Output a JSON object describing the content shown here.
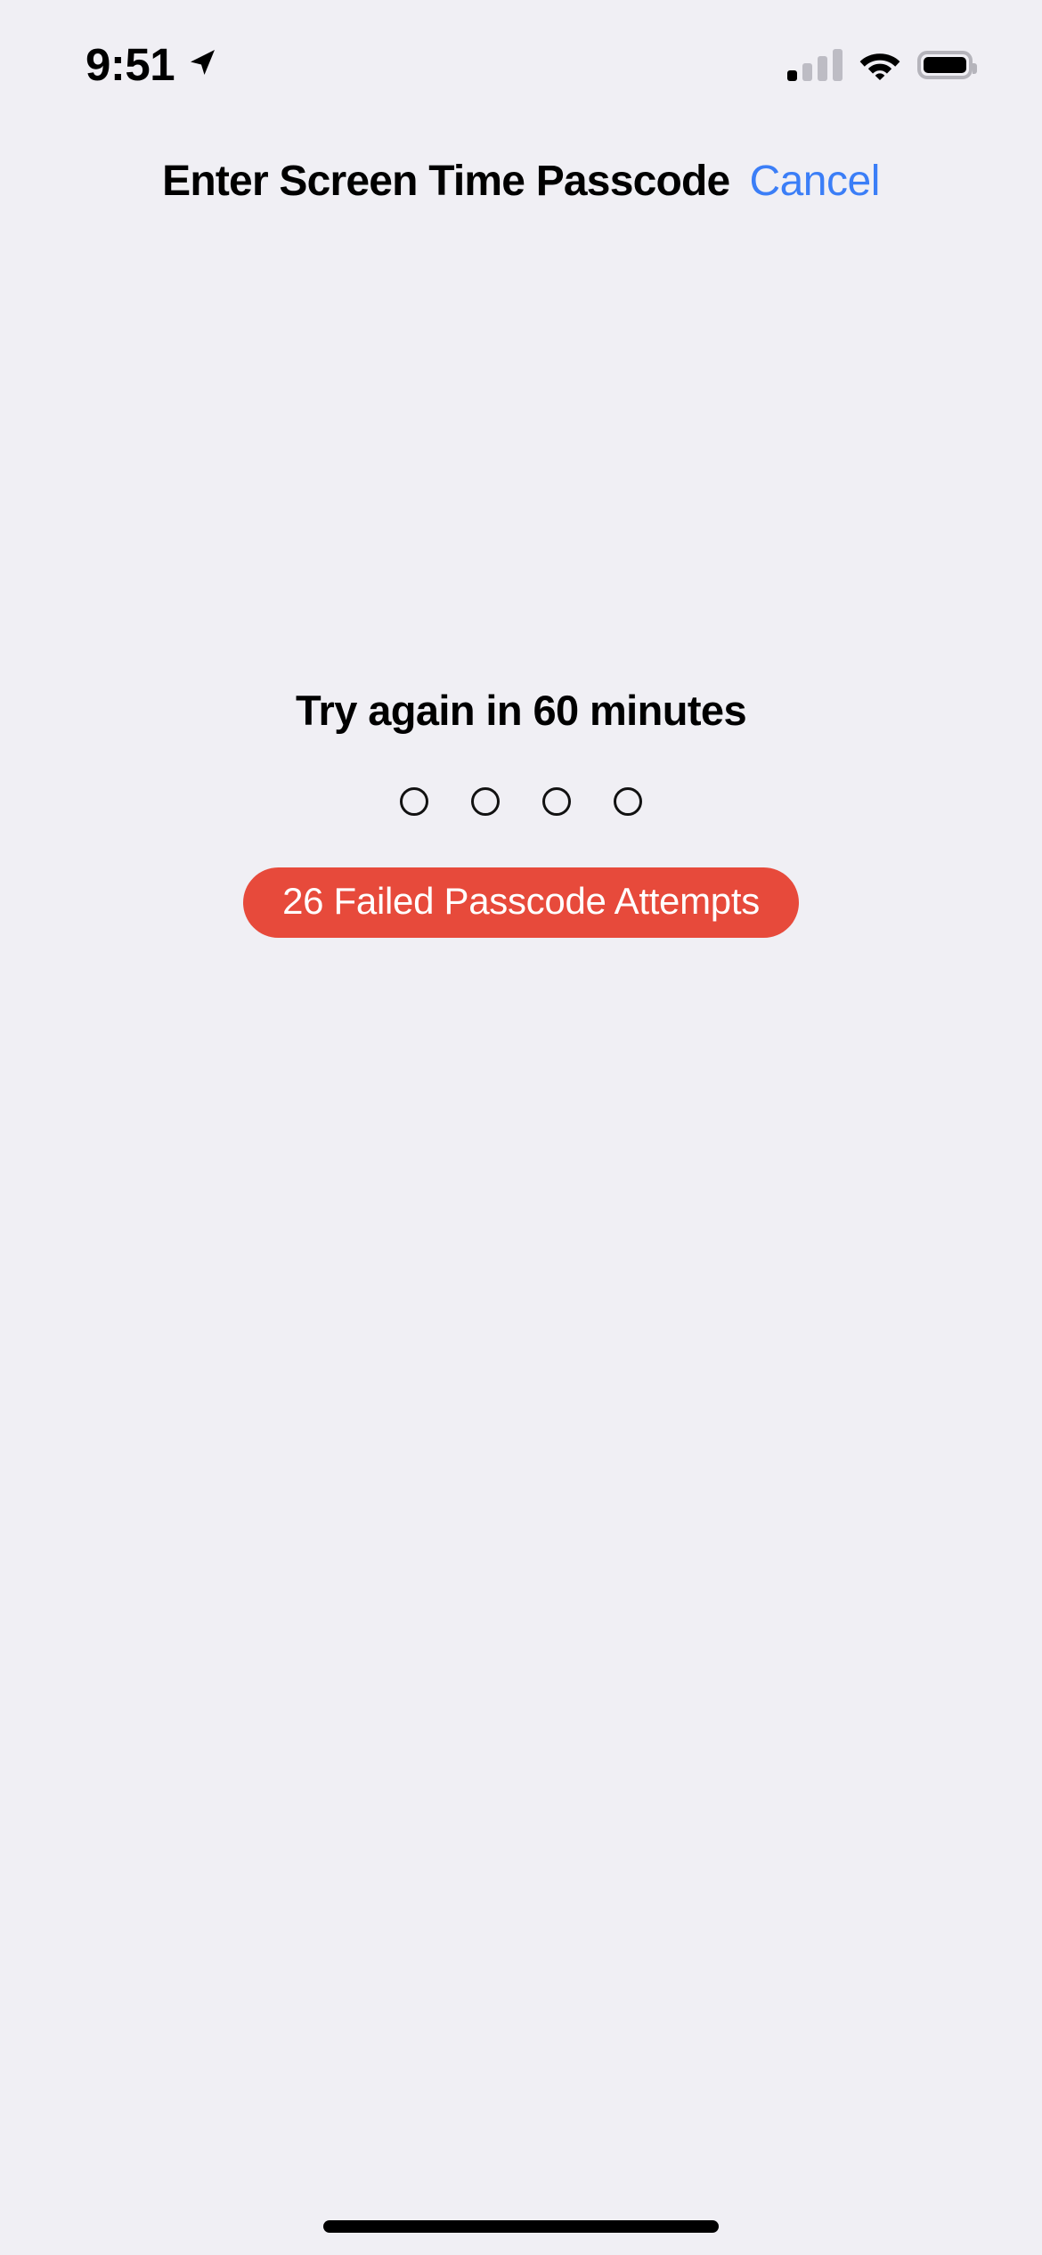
{
  "status_bar": {
    "time": "9:51",
    "location_icon": "location-arrow-icon",
    "cellular_icon": "cellular-signal-icon",
    "cellular_bars_filled": 1,
    "cellular_bars_total": 4,
    "wifi_icon": "wifi-icon",
    "battery_icon": "battery-icon",
    "battery_level_percent": 100
  },
  "header": {
    "title": "Enter Screen Time Passcode",
    "cancel_label": "Cancel"
  },
  "main": {
    "retry_message": "Try again in 60 minutes",
    "passcode": {
      "length": 4,
      "entered": 0,
      "dots": [
        "",
        "",
        "",
        ""
      ]
    },
    "failed_attempts_badge": "26 Failed Passcode Attempts"
  },
  "colors": {
    "background": "#F0EFF4",
    "accent_blue": "#3B7EF7",
    "error_red": "#E74A3B",
    "text_primary": "#000000",
    "badge_text": "#FFFFFF",
    "signal_inactive": "#BDBCC4",
    "battery_outline": "#B5B4BB"
  },
  "home_indicator": "home-indicator"
}
